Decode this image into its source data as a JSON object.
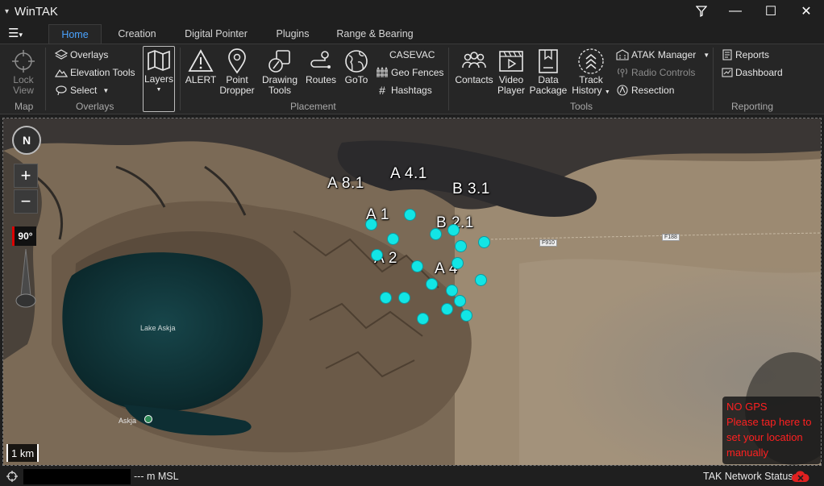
{
  "app": {
    "title": "WinTAK",
    "menu_glyph": "▾",
    "controls": {
      "minimize": "—",
      "maximize": "☐",
      "close": "✕"
    }
  },
  "tabs": [
    {
      "label": "Home",
      "active": true
    },
    {
      "label": "Creation",
      "active": false
    },
    {
      "label": "Digital Pointer",
      "active": false
    },
    {
      "label": "Plugins",
      "active": false
    },
    {
      "label": "Range & Bearing",
      "active": false
    }
  ],
  "ribbon": {
    "map_group": {
      "label": "Map",
      "lock_view": "Lock\nView"
    },
    "overlays_group": {
      "label": "Overlays",
      "overlays": "Overlays",
      "elevation_tools": "Elevation Tools",
      "select": "Select",
      "layers": "Layers"
    },
    "placement_group": {
      "label": "Placement",
      "alert": "ALERT",
      "point_dropper": "Point\nDropper",
      "drawing_tools": "Drawing\nTools",
      "routes": "Routes",
      "goto": "GoTo",
      "casevac": "CASEVAC",
      "geo_fences": "Geo Fences",
      "hashtags": "Hashtags"
    },
    "tools_group": {
      "label": "Tools",
      "contacts": "Contacts",
      "video_player": "Video\nPlayer",
      "data_package": "Data\nPackage",
      "track_history": "Track\nHistory",
      "atak_manager": "ATAK Manager",
      "radio_controls": "Radio Controls",
      "resection": "Resection"
    },
    "reporting_group": {
      "label": "Reporting",
      "reports": "Reports",
      "dashboard": "Dashboard"
    }
  },
  "map": {
    "compass": "N",
    "zoom_in": "+",
    "zoom_out": "−",
    "tilt": "90°",
    "scale": "1 km",
    "lake_label": "Lake Askja",
    "place_label": "Askja",
    "road_tags": [
      "F910",
      "F188"
    ],
    "unit_labels": [
      "A 8.1",
      "A 4.1",
      "B 3.1",
      "A 1",
      "B 2.1",
      "A 2",
      "A 4"
    ],
    "marker_count": 22,
    "gps_warning": {
      "line1": "NO GPS",
      "line2": "Please tap here to set your location manually"
    },
    "colors": {
      "marker": "#12e5e5",
      "lake": "#0d2e33",
      "terrain": "#6e5c4a",
      "lava": "#2b2a2c"
    }
  },
  "status": {
    "altitude": "--- m MSL",
    "network": "TAK Network Status"
  }
}
